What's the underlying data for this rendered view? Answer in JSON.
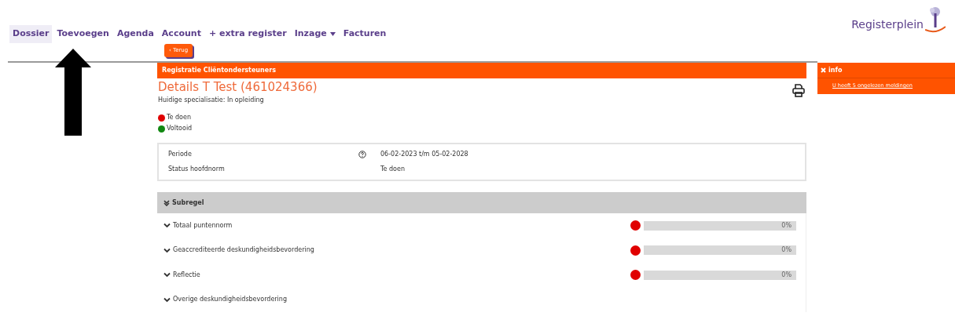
{
  "nav": {
    "items": [
      {
        "label": "Dossier",
        "selected": true
      },
      {
        "label": "Toevoegen",
        "selected": false
      },
      {
        "label": "Agenda",
        "selected": false
      },
      {
        "label": "Account",
        "selected": false
      },
      {
        "label": "+ extra register",
        "selected": false
      },
      {
        "label": "Inzage",
        "selected": false,
        "dropdown": true
      },
      {
        "label": "Facturen",
        "selected": false
      }
    ]
  },
  "logo": {
    "text": "Registerplein"
  },
  "back_button": {
    "icon": "‹",
    "label": "Terug"
  },
  "header": {
    "title": "Registratie Cliëntondersteuners"
  },
  "details": {
    "title": "Details T Test (461024366)",
    "subtitle": "Huidige specialisatie: In opleiding"
  },
  "legend": [
    {
      "label": "Te doen",
      "color": "#e00000"
    },
    {
      "label": "Voltooid",
      "color": "#118811"
    }
  ],
  "summary": [
    {
      "label": "Periode",
      "help": true,
      "value": "06-02-2023 t/m 05-02-2028"
    },
    {
      "label": "Status hoofdnorm",
      "help": false,
      "value": "Te doen"
    }
  ],
  "subregel": {
    "title": "Subregel",
    "rows": [
      {
        "label": "Totaal puntennorm",
        "color": "#e00000",
        "level": 0,
        "reading": "0%"
      },
      {
        "label": "Geaccrediteerde deskundigheidsbevordering",
        "color": "#e00000",
        "level": 0,
        "reading": "0%"
      },
      {
        "label": "Reflectie",
        "color": "#e00000",
        "level": 0,
        "reading": "0%"
      },
      {
        "label": "Overige deskundigheidsbevordering"
      }
    ]
  },
  "info": {
    "title": "info",
    "link": "U heeft 5 ongelezen meldingen"
  }
}
